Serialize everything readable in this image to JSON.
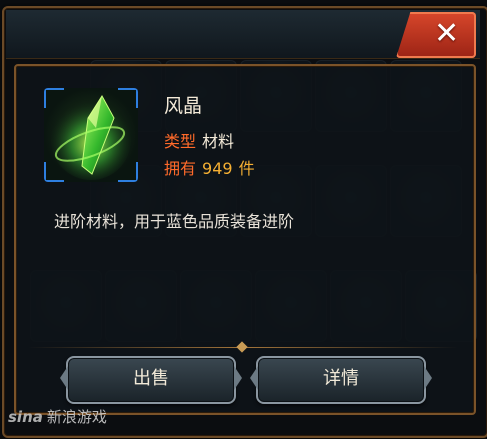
{
  "dialog": {
    "close_label": "✕"
  },
  "item": {
    "name": "风晶",
    "type_label": "类型",
    "type_value": "材料",
    "own_label": "拥有",
    "own_count": "949",
    "own_unit": "件",
    "icon": "green-crystal-icon",
    "description": "进阶材料，用于蓝色品质装备进阶"
  },
  "actions": {
    "sell_label": "出售",
    "detail_label": "详情"
  },
  "watermark": {
    "brand": "sina",
    "text": "新浪游戏"
  },
  "colors": {
    "label_orange": "#ff6a2a",
    "count_gold": "#f6b033",
    "close_red": "#d8472b",
    "frame_bronze": "#7b5329",
    "icon_border_blue": "#2e7fe0"
  }
}
